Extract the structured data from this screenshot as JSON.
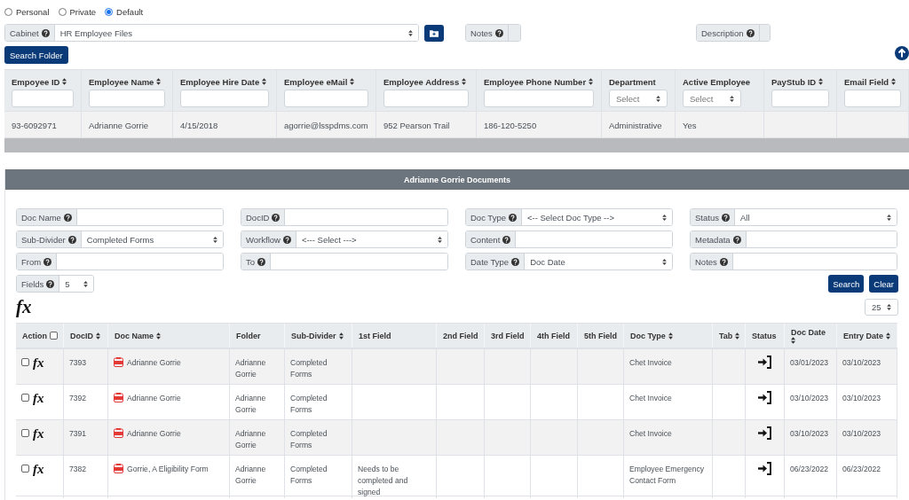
{
  "scope_options": [
    {
      "label": "Personal",
      "selected": false
    },
    {
      "label": "Private",
      "selected": false
    },
    {
      "label": "Default",
      "selected": true
    }
  ],
  "cabinet": {
    "label": "Cabinet",
    "value": "HR Employee Files"
  },
  "notes": {
    "label": "Notes"
  },
  "description": {
    "label": "Description"
  },
  "search_folder_button": "Search Folder",
  "folder_table": {
    "columns": [
      {
        "label": "Empoyee ID",
        "sortable": true,
        "kind": "input"
      },
      {
        "label": "Employee Name",
        "sortable": true,
        "kind": "input"
      },
      {
        "label": "Employee Hire Date",
        "sortable": true,
        "kind": "input"
      },
      {
        "label": "Employee eMail",
        "sortable": true,
        "kind": "input"
      },
      {
        "label": "Employee Address",
        "sortable": true,
        "kind": "input"
      },
      {
        "label": "Employee Phone Number",
        "sortable": true,
        "kind": "input"
      },
      {
        "label": "Department",
        "sortable": false,
        "kind": "select",
        "value": "Select"
      },
      {
        "label": "Active Employee",
        "sortable": false,
        "kind": "select",
        "value": "Select"
      },
      {
        "label": "PayStub ID",
        "sortable": true,
        "kind": "input"
      },
      {
        "label": "Email Field",
        "sortable": true,
        "kind": "input"
      }
    ],
    "rows": [
      [
        "93-6092971",
        "Adrianne Gorrie",
        "4/15/2018",
        "agorrie@lsspdms.com",
        "952 Pearson Trail",
        "186-120-5250",
        "Administrative",
        "Yes",
        null,
        null
      ]
    ]
  },
  "documents": {
    "title": "Adrianne Gorrie Documents",
    "filters": [
      {
        "label": "Doc Name",
        "kind": "input"
      },
      {
        "label": "DocID",
        "kind": "input"
      },
      {
        "label": "Doc Type",
        "kind": "select",
        "value": "<-- Select Doc Type -->"
      },
      {
        "label": "Status",
        "kind": "select",
        "value": "All"
      },
      {
        "label": "Sub-Divider",
        "kind": "select",
        "value": "Completed Forms"
      },
      {
        "label": "Workflow",
        "kind": "select",
        "value": "<--- Select --->"
      },
      {
        "label": "Content",
        "kind": "input"
      },
      {
        "label": "Metadata",
        "kind": "input"
      },
      {
        "label": "From",
        "kind": "input"
      },
      {
        "label": "To",
        "kind": "input"
      },
      {
        "label": "Date Type",
        "kind": "select",
        "value": "Doc Date"
      },
      {
        "label": "Notes",
        "kind": "input"
      }
    ],
    "fields_filter": {
      "label": "Fields",
      "value": "5"
    },
    "buttons": [
      "Search",
      "Clear"
    ],
    "formula_label": "fx",
    "page_size": "25",
    "table": {
      "select_all_checked": false,
      "columns": [
        {
          "label": "Action",
          "sortable": false,
          "kind": "action"
        },
        {
          "label": "DocID",
          "sortable": true,
          "kind": "text"
        },
        {
          "label": "Doc Name",
          "sortable": true,
          "kind": "document"
        },
        {
          "label": "Folder",
          "sortable": false,
          "kind": "text"
        },
        {
          "label": "Sub-Divider",
          "sortable": true,
          "kind": "text"
        },
        {
          "label": "1st Field",
          "sortable": false,
          "kind": "text"
        },
        {
          "label": "2nd Field",
          "sortable": false,
          "kind": "text"
        },
        {
          "label": "3rd Field",
          "sortable": false,
          "kind": "text"
        },
        {
          "label": "4th Field",
          "sortable": false,
          "kind": "text"
        },
        {
          "label": "5th Field",
          "sortable": false,
          "kind": "text"
        },
        {
          "label": "Doc Type",
          "sortable": true,
          "kind": "text"
        },
        {
          "label": "Tab",
          "sortable": true,
          "kind": "text"
        },
        {
          "label": "Status",
          "sortable": false,
          "kind": "status"
        },
        {
          "label": "Doc Date",
          "sortable": true,
          "kind": "text"
        },
        {
          "label": "Entry Date",
          "sortable": true,
          "kind": "text"
        }
      ],
      "rows": [
        {
          "checked": false,
          "action_label": "fx",
          "cells": [
            null,
            "7393",
            "Adrianne Gorrie",
            "Adrianne Gorrie",
            "Completed Forms",
            null,
            null,
            null,
            null,
            null,
            "Chet Invoice",
            null,
            null,
            "03/01/2023",
            "03/10/2023"
          ]
        },
        {
          "checked": false,
          "action_label": "fx",
          "cells": [
            null,
            "7392",
            "Adrianne Gorrie",
            "Adrianne Gorrie",
            "Completed Forms",
            null,
            null,
            null,
            null,
            null,
            "Chet Invoice",
            null,
            null,
            "03/10/2023",
            "03/10/2023"
          ]
        },
        {
          "checked": false,
          "action_label": "fx",
          "cells": [
            null,
            "7391",
            "Adrianne Gorrie",
            "Adrianne Gorrie",
            "Completed Forms",
            null,
            null,
            null,
            null,
            null,
            "Chet Invoice",
            null,
            null,
            "03/10/2023",
            "03/10/2023"
          ]
        },
        {
          "checked": false,
          "action_label": "fx",
          "cells": [
            null,
            "7382",
            "Gorrie, A Eligibility Form",
            "Adrianne Gorrie",
            "Completed Forms",
            "Needs to be completed and signed",
            null,
            null,
            null,
            null,
            "Employee Emergency Contact Form",
            null,
            null,
            "06/23/2022",
            "06/23/2022"
          ]
        }
      ]
    }
  }
}
